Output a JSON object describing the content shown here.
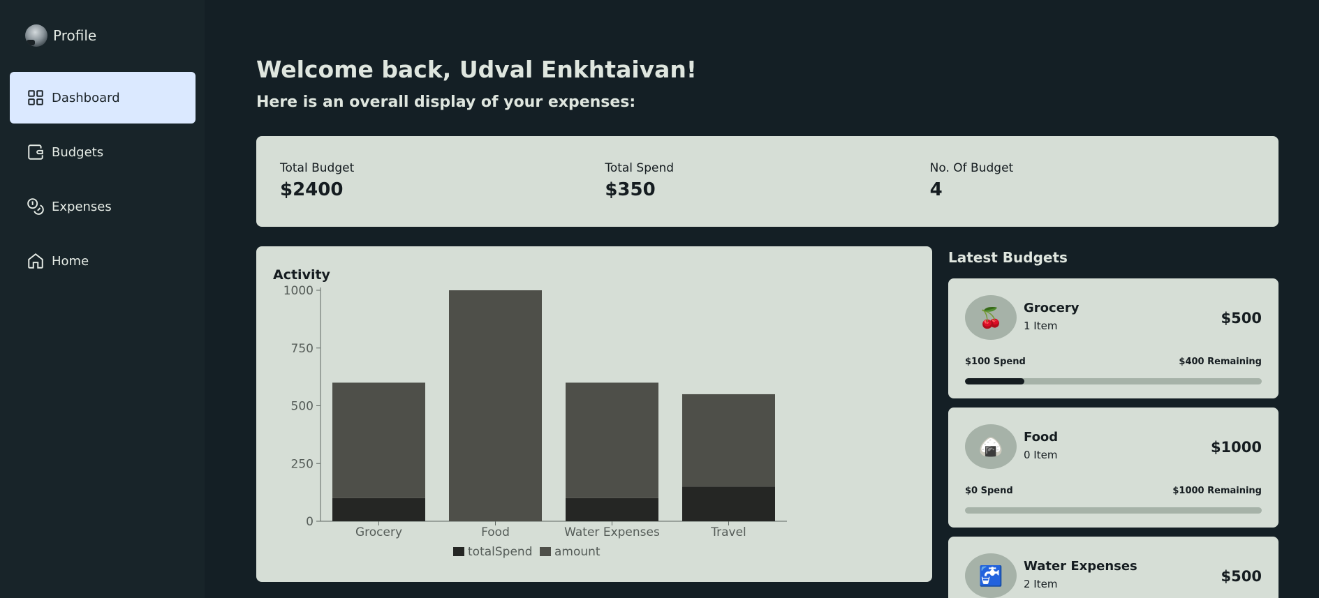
{
  "sidebar": {
    "profile_label": "Profile",
    "nav": [
      {
        "label": "Dashboard",
        "icon": "dashboard-icon",
        "active": true
      },
      {
        "label": "Budgets",
        "icon": "wallet-icon",
        "active": false
      },
      {
        "label": "Expenses",
        "icon": "coins-icon",
        "active": false
      },
      {
        "label": "Home",
        "icon": "home-icon",
        "active": false
      }
    ]
  },
  "header": {
    "welcome": "Welcome back, Udval Enkhtaivan!",
    "subtitle": "Here is an overall display of your expenses:"
  },
  "stats": [
    {
      "label": "Total Budget",
      "value": "$2400"
    },
    {
      "label": "Total Spend",
      "value": "$350"
    },
    {
      "label": "No. Of Budget",
      "value": "4"
    }
  ],
  "activity": {
    "title": "Activity",
    "chart_data": {
      "type": "bar",
      "stacked": true,
      "categories": [
        "Grocery",
        "Food",
        "Water Expenses",
        "Travel"
      ],
      "series": [
        {
          "name": "totalSpend",
          "values": [
            100,
            0,
            100,
            150
          ],
          "color": "#252624"
        },
        {
          "name": "amount",
          "values": [
            500,
            1000,
            500,
            400
          ],
          "color": "#4e4f49"
        }
      ],
      "yticks": [
        "0",
        "250",
        "500",
        "750",
        "1000"
      ],
      "ylim": [
        0,
        1000
      ],
      "legend": "bottom"
    }
  },
  "latest_budgets": {
    "title": "Latest Budgets",
    "items": [
      {
        "emoji": "🍒",
        "name": "Grocery",
        "items": "1 Item",
        "amount": "$500",
        "spend": "$100 Spend",
        "remaining": "$400 Remaining",
        "progress": 0.2
      },
      {
        "emoji": "🍙",
        "name": "Food",
        "items": "0 Item",
        "amount": "$1000",
        "spend": "$0 Spend",
        "remaining": "$1000 Remaining",
        "progress": 0
      },
      {
        "emoji": "🚰",
        "name": "Water Expenses",
        "items": "2 Item",
        "amount": "$500"
      }
    ]
  }
}
